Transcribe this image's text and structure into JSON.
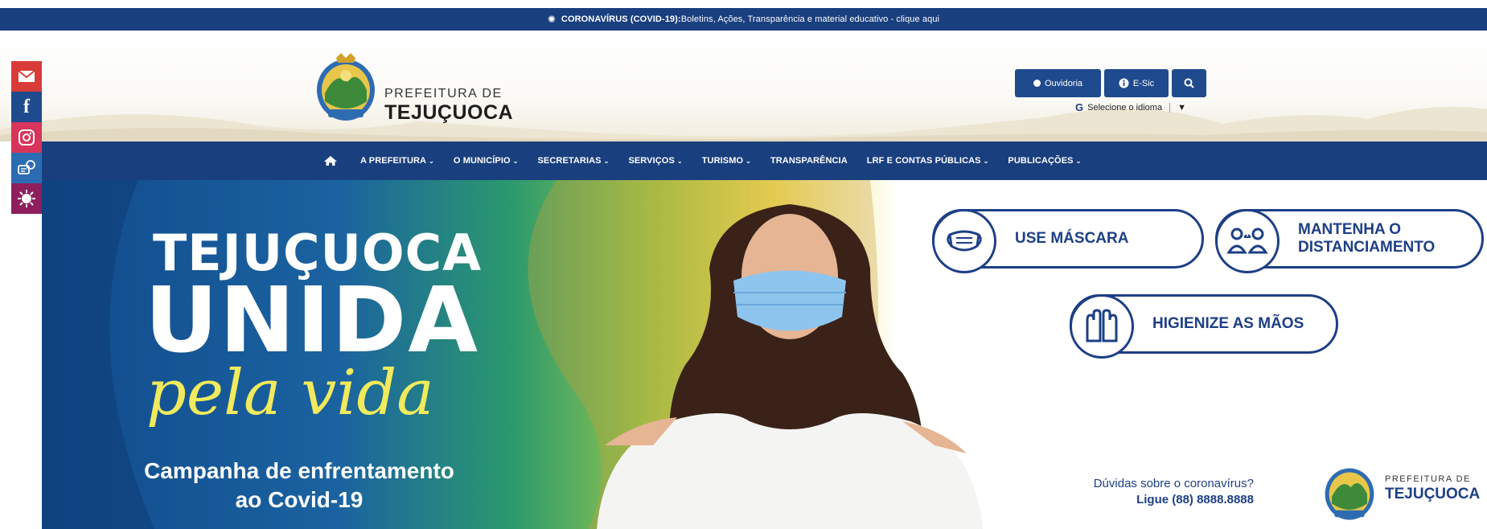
{
  "alert": {
    "title": "CORONAVÍRUS (COVID-19):",
    "text": " Boletins, Ações, Transparência e material educativo - clique aqui"
  },
  "header": {
    "logo_prefix": "PREFEITURA DE",
    "logo_name": "TEJUÇUOCA",
    "buttons": {
      "ouvidoria": "Ouvidoria",
      "esic": "E-Sic"
    },
    "language_label": "Selecione o idioma",
    "language_arrow": "▼"
  },
  "nav": {
    "items": [
      {
        "label": "A PREFEITURA",
        "chev": "⌄"
      },
      {
        "label": "O MUNICÍPIO",
        "chev": "⌄"
      },
      {
        "label": "SECRETARIAS",
        "chev": "⌄"
      },
      {
        "label": "SERVIÇOS",
        "chev": "⌄"
      },
      {
        "label": "TURISMO",
        "chev": "⌄"
      },
      {
        "label": "TRANSPARÊNCIA",
        "chev": ""
      },
      {
        "label": "LRF E CONTAS PÚBLICAS",
        "chev": "⌄"
      },
      {
        "label": "PUBLICAÇÕES",
        "chev": "⌄"
      }
    ]
  },
  "banner": {
    "title_line1": "TEJUÇUOCA",
    "title_line2": "UNIDA",
    "title_line3": "pela vida",
    "subtitle_line1": "Campanha de enfrentamento",
    "subtitle_line2": "ao Covid-19",
    "pills": {
      "mask": "USE MÁSCARA",
      "distance_line1": "MANTENHA O",
      "distance_line2": "DISTANCIAMENTO",
      "hands": "HIGIENIZE AS MÃOS"
    },
    "doubt_line1": "Dúvidas sobre o coronavírus?",
    "doubt_line2": "Ligue (88) 8888.8888",
    "footer_logo_prefix": "PREFEITURA DE",
    "footer_logo_name": "TEJUÇUOCA"
  },
  "colors": {
    "brand_blue": "#1a3f7e",
    "banner_yellow": "#f0ea5c",
    "mail_red": "#d83b38",
    "instagram_pink": "#d7355b"
  }
}
